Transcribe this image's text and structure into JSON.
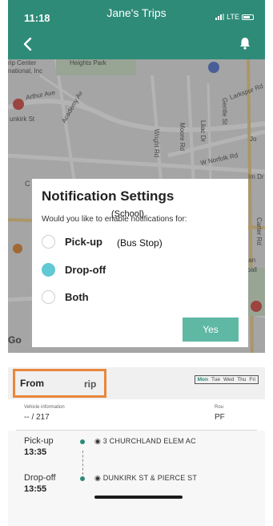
{
  "status_bar": {
    "time": "11:18",
    "carrier": "LTE"
  },
  "header": {
    "title": "Jane's Trips",
    "back_icon": "chevron-left-icon",
    "bell_icon": "bell-icon"
  },
  "map": {
    "labels": {
      "ripcenter": "rip Center",
      "national": "national, Inc",
      "heights_park": "Heights Park",
      "arthur_ave": "Arthur Ave",
      "academy": "Academy Av",
      "wright_rd": "Wright Rd",
      "moore_rd": "Moore Rd",
      "lilac_dr": "Lilac Dr",
      "gentle_st": "Gentle St",
      "larkspur": "Larkspur Rd",
      "w_norfolk": "W Norfolk Rd",
      "carter_rd": "Carter Rd",
      "chlan": "chlan",
      "seball": "seball",
      "im_dr": "Im Dr",
      "jo": "Jo",
      "c": "C",
      "unkirk": "unkirk St",
      "google": "Go"
    }
  },
  "modal": {
    "title": "Notification Settings",
    "question": "Would you like to enable notifications for:",
    "school_overlay": "(School)",
    "busstop_overlay": "(Bus Stop)",
    "options": [
      {
        "label": "Pick-up",
        "selected": false
      },
      {
        "label": "Drop-off",
        "selected": true
      },
      {
        "label": "Both",
        "selected": false
      }
    ],
    "confirm_label": "Yes",
    "accent": "#61c8d4",
    "button_color": "#5fb8a3"
  },
  "sheet": {
    "from_tab": "From",
    "trip_tab": "rip",
    "days": [
      "Mon",
      "Tue",
      "Wed",
      "Thu",
      "Fri"
    ],
    "active_day": "Mon",
    "vehicle_label": "Vehicle information",
    "vehicle_value": "-- / 217",
    "route_label": "Rou",
    "route_value": "PF",
    "stops": [
      {
        "label": "Pick-up",
        "time": "13:35",
        "name": "3 CHURCHLAND ELEM AC"
      },
      {
        "label": "Drop-off",
        "time": "13:55",
        "name": "DUNKIRK ST & PIERCE ST"
      }
    ]
  },
  "colors": {
    "header_green": "#2e8b78",
    "highlight_orange": "#e8873c"
  }
}
